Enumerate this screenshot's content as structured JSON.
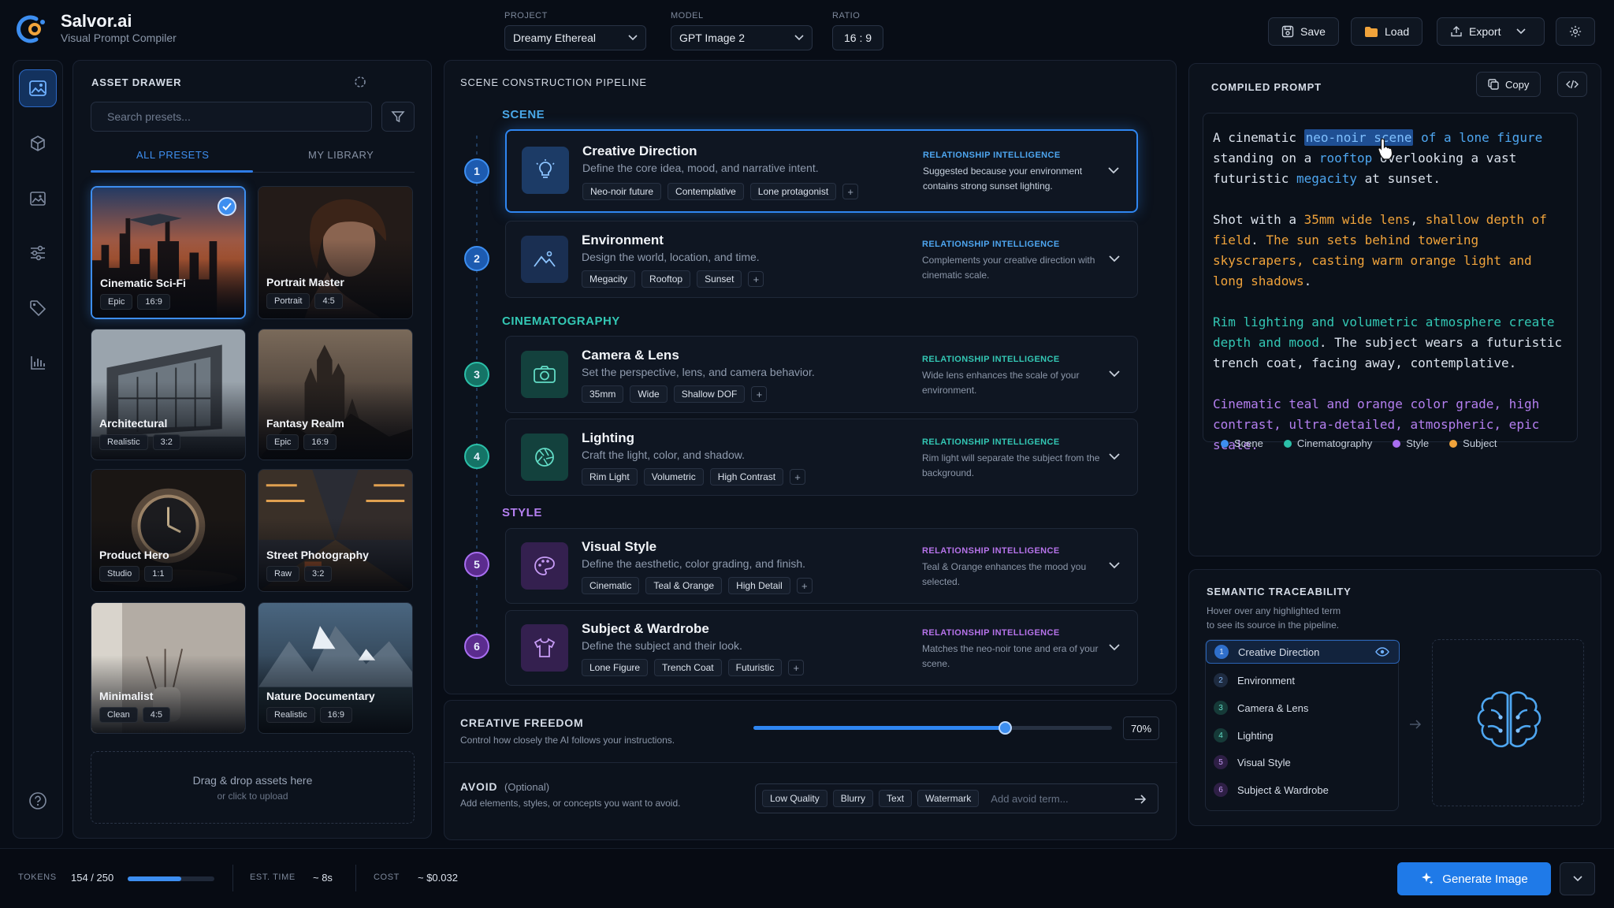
{
  "app": {
    "name": "Salvor.ai",
    "subtitle": "Visual Prompt Compiler"
  },
  "header": {
    "project": {
      "label": "PROJECT",
      "value": "Dreamy Ethereal"
    },
    "model": {
      "label": "MODEL",
      "value": "GPT Image 2"
    },
    "ratio": {
      "label": "RATIO",
      "value": "16 : 9"
    },
    "save": "Save",
    "load": "Load",
    "export": "Export"
  },
  "rail": {
    "items": [
      {
        "icon": "image-gallery-icon",
        "active": true
      },
      {
        "icon": "cube-icon",
        "active": false
      },
      {
        "icon": "picture-icon",
        "active": false
      },
      {
        "icon": "sliders-icon",
        "active": false
      },
      {
        "icon": "tag-icon",
        "active": false
      },
      {
        "icon": "bar-chart-icon",
        "active": false
      }
    ],
    "help_icon": "help-icon"
  },
  "drawer": {
    "title": "ASSET DRAWER",
    "search_placeholder": "Search presets...",
    "tabs": [
      "ALL PRESETS",
      "MY LIBRARY"
    ],
    "presets": [
      {
        "name": "Cinematic Sci-Fi",
        "tags": [
          "Epic",
          "16:9"
        ],
        "selected": true
      },
      {
        "name": "Portrait Master",
        "tags": [
          "Portrait",
          "4:5"
        ],
        "selected": false
      },
      {
        "name": "Architectural",
        "tags": [
          "Realistic",
          "3:2"
        ],
        "selected": false
      },
      {
        "name": "Fantasy Realm",
        "tags": [
          "Epic",
          "16:9"
        ],
        "selected": false
      },
      {
        "name": "Product Hero",
        "tags": [
          "Studio",
          "1:1"
        ],
        "selected": false
      },
      {
        "name": "Street Photography",
        "tags": [
          "Raw",
          "3:2"
        ],
        "selected": false
      },
      {
        "name": "Minimalist",
        "tags": [
          "Clean",
          "4:5"
        ],
        "selected": false
      },
      {
        "name": "Nature Documentary",
        "tags": [
          "Realistic",
          "16:9"
        ],
        "selected": false
      }
    ],
    "dropzone": {
      "title": "Drag & drop assets here",
      "sub": "or click to upload"
    }
  },
  "pipeline": {
    "title": "SCENE CONSTRUCTION PIPELINE",
    "sections": [
      "SCENE",
      "CINEMATOGRAPHY",
      "STYLE"
    ],
    "ri_label": "RELATIONSHIP INTELLIGENCE",
    "steps": [
      {
        "num": "1",
        "title": "Creative Direction",
        "desc": "Define the core idea, mood, and narrative intent.",
        "chips": [
          "Neo-noir future",
          "Contemplative",
          "Lone protagonist"
        ],
        "ri": "Suggested because your environment contains strong sunset lighting."
      },
      {
        "num": "2",
        "title": "Environment",
        "desc": "Design the world, location, and time.",
        "chips": [
          "Megacity",
          "Rooftop",
          "Sunset"
        ],
        "ri": "Complements your creative direction with cinematic scale."
      },
      {
        "num": "3",
        "title": "Camera & Lens",
        "desc": "Set the perspective, lens, and camera behavior.",
        "chips": [
          "35mm",
          "Wide",
          "Shallow DOF"
        ],
        "ri": "Wide lens enhances the scale of your environment."
      },
      {
        "num": "4",
        "title": "Lighting",
        "desc": "Craft the light, color, and shadow.",
        "chips": [
          "Rim Light",
          "Volumetric",
          "High Contrast"
        ],
        "ri": "Rim light will separate the subject from the background."
      },
      {
        "num": "5",
        "title": "Visual Style",
        "desc": "Define the aesthetic, color grading, and finish.",
        "chips": [
          "Cinematic",
          "Teal & Orange",
          "High Detail"
        ],
        "ri": "Teal & Orange enhances the mood you selected."
      },
      {
        "num": "6",
        "title": "Subject & Wardrobe",
        "desc": "Define the subject and their look.",
        "chips": [
          "Lone Figure",
          "Trench Coat",
          "Futuristic"
        ],
        "ri": "Matches the neo-noir tone and era of your scene."
      }
    ]
  },
  "freedom": {
    "title": "CREATIVE FREEDOM",
    "desc": "Control how closely the AI follows your instructions.",
    "value": 0.7,
    "value_label": "70%"
  },
  "avoid": {
    "title": "AVOID",
    "optional": "(Optional)",
    "desc": "Add elements, styles, or concepts you want to avoid.",
    "chips": [
      "Low Quality",
      "Blurry",
      "Text",
      "Watermark"
    ],
    "placeholder": "Add avoid term..."
  },
  "compiled": {
    "title": "COMPILED PROMPT",
    "copy": "Copy",
    "p1": [
      {
        "t": "A cinematic ",
        "c": "plain"
      },
      {
        "t": "neo-noir scene",
        "c": "hl"
      },
      {
        "t": " of a lone figure",
        "c": "scene"
      },
      {
        "t": " standing on a ",
        "c": "plain"
      },
      {
        "t": "rooftop",
        "c": "scene"
      },
      {
        "t": " overlooking a vast futuristic ",
        "c": "plain"
      },
      {
        "t": "megacity",
        "c": "scene"
      },
      {
        "t": " at sunset.",
        "c": "plain"
      }
    ],
    "p2": [
      {
        "t": "Shot with a ",
        "c": "plain"
      },
      {
        "t": "35mm wide lens",
        "c": "subj"
      },
      {
        "t": ", ",
        "c": "plain"
      },
      {
        "t": "shallow depth of field",
        "c": "subj"
      },
      {
        "t": ". ",
        "c": "plain"
      },
      {
        "t": "The sun sets behind towering skyscrapers, casting warm orange light and long shadows",
        "c": "subj"
      },
      {
        "t": ".",
        "c": "plain"
      }
    ],
    "p3": [
      {
        "t": "Rim lighting and volumetric atmosphere create depth and mood",
        "c": "cine"
      },
      {
        "t": ". The subject wears a futuristic trench coat, facing away, contemplative.",
        "c": "plain"
      }
    ],
    "p4": [
      {
        "t": "Cinematic teal and orange color grade, high contrast, ultra-detailed, atmospheric, epic scale.",
        "c": "style"
      }
    ],
    "legend": [
      {
        "label": "Scene",
        "color": "#3d8ef0"
      },
      {
        "label": "Cinematography",
        "color": "#2bbfa8"
      },
      {
        "label": "Style",
        "color": "#a86ef0"
      },
      {
        "label": "Subject",
        "color": "#f0a33b"
      }
    ]
  },
  "trace": {
    "title": "SEMANTIC TRACEABILITY",
    "desc1": "Hover over any highlighted term",
    "desc2": "to see its source in the pipeline.",
    "items": [
      "Creative Direction",
      "Environment",
      "Camera & Lens",
      "Lighting",
      "Visual Style",
      "Subject & Wardrobe"
    ]
  },
  "footer": {
    "tokens_label": "TOKENS",
    "tokens_value": "154 / 250",
    "tokens_fraction": 0.616,
    "time_label": "EST. TIME",
    "time_value": "~ 8s",
    "cost_label": "COST",
    "cost_value": "~ $0.032",
    "generate": "Generate Image"
  },
  "colors": {
    "accent": "#2f86f1",
    "scene": "#3d8ef0",
    "cinematography": "#2bbfa8",
    "style": "#a86ef0",
    "subject": "#f0a33b",
    "relationship": "#b673ea"
  }
}
